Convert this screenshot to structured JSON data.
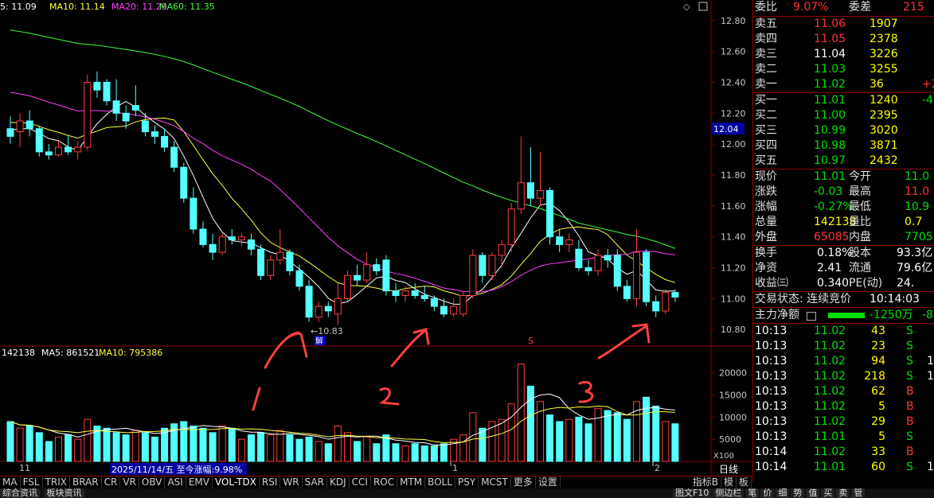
{
  "ma_legend": {
    "ma5": "5: 11.09",
    "ma10": "MA10: 11.14",
    "ma20": "MA20: 11.29",
    "ma60": "MA60: 11.35"
  },
  "price_axis": [
    "12.80",
    "12.60",
    "12.40",
    "12.20",
    "12.00",
    "11.80",
    "11.60",
    "11.40",
    "11.20",
    "11.00",
    "10.80"
  ],
  "current_price_tag": "12.04",
  "low_marker": "10.83",
  "jie_marker": "解",
  "s_marker": "S",
  "volume_legend": {
    "vol": "142138",
    "ma5": "MA5: 861521",
    "ma10": "MA10: 795386"
  },
  "volume_axis": [
    "20000",
    "15000",
    "10000",
    "5000"
  ],
  "volume_unit": "X100",
  "date_axis": {
    "d1": "11",
    "d2": "1",
    "d3": "2"
  },
  "date_tooltip": "2025/11/14/五 至今涨幅:9.98%",
  "daily_label": "日线",
  "annotations": [
    "1",
    "2",
    "3"
  ],
  "right_panel": {
    "weibi_label": "委比",
    "weibi_value": "9.07%",
    "weicha_label": "委差",
    "weicha_value": "215",
    "asks": [
      {
        "label": "卖五",
        "price": "11.06",
        "vol": "1907",
        "extra": ""
      },
      {
        "label": "卖四",
        "price": "11.05",
        "vol": "2378",
        "extra": ""
      },
      {
        "label": "卖三",
        "price": "11.04",
        "vol": "3226",
        "extra": ""
      },
      {
        "label": "卖二",
        "price": "11.03",
        "vol": "3255",
        "extra": ""
      },
      {
        "label": "卖一",
        "price": "11.02",
        "vol": "36",
        "extra": "+2"
      }
    ],
    "bids": [
      {
        "label": "买一",
        "price": "11.01",
        "vol": "1240",
        "extra": "-4"
      },
      {
        "label": "买二",
        "price": "11.00",
        "vol": "2395",
        "extra": ""
      },
      {
        "label": "买三",
        "price": "10.99",
        "vol": "3020",
        "extra": ""
      },
      {
        "label": "买四",
        "price": "10.98",
        "vol": "3871",
        "extra": ""
      },
      {
        "label": "买五",
        "price": "10.97",
        "vol": "2432",
        "extra": ""
      }
    ],
    "stats": [
      {
        "l1": "现价",
        "v1": "11.01",
        "l2": "今开",
        "v2": "11.0"
      },
      {
        "l1": "涨跌",
        "v1": "-0.03",
        "l2": "最高",
        "v2": "11.0"
      },
      {
        "l1": "涨幅",
        "v1": "-0.27%",
        "l2": "最低",
        "v2": "10.9"
      },
      {
        "l1": "总量",
        "v1": "142138",
        "l2": "量比",
        "v2": "0.7"
      },
      {
        "l1": "外盘",
        "v1": "65085",
        "l2": "内盘",
        "v2": "7705"
      }
    ],
    "stats2": [
      {
        "l1": "换手",
        "v1": "0.18%",
        "l2": "股本",
        "v2": "93.3亿"
      },
      {
        "l1": "净资",
        "v1": "2.41",
        "l2": "流通",
        "v2": "79.6亿"
      },
      {
        "l1": "收益㈢",
        "v1": "0.340",
        "l2": "PE(动)",
        "v2": "24."
      }
    ],
    "trade_status": "交易状态: 连续竞价",
    "trade_time": "10:14:03",
    "net_flow_label": "主力净额",
    "net_flow_value": "-1250万",
    "net_flow_extra": "-8",
    "ticks": [
      {
        "time": "10:13",
        "price": "11.02",
        "vol": "43",
        "side": "S",
        "n": ""
      },
      {
        "time": "10:13",
        "price": "11.02",
        "vol": "23",
        "side": "S",
        "n": ""
      },
      {
        "time": "10:13",
        "price": "11.02",
        "vol": "94",
        "side": "S",
        "n": "1"
      },
      {
        "time": "10:13",
        "price": "11.02",
        "vol": "218",
        "side": "S",
        "n": "1"
      },
      {
        "time": "10:13",
        "price": "11.02",
        "vol": "62",
        "side": "B",
        "n": ""
      },
      {
        "time": "10:13",
        "price": "11.02",
        "vol": "5",
        "side": "B",
        "n": ""
      },
      {
        "time": "10:13",
        "price": "11.02",
        "vol": "29",
        "side": "B",
        "n": ""
      },
      {
        "time": "10:13",
        "price": "11.01",
        "vol": "5",
        "side": "S",
        "n": ""
      },
      {
        "time": "10:14",
        "price": "11.02",
        "vol": "33",
        "side": "B",
        "n": ""
      },
      {
        "time": "10:14",
        "price": "11.01",
        "vol": "60",
        "side": "S",
        "n": "1"
      }
    ]
  },
  "indicator_tabs": [
    "MA",
    "FSL",
    "TRIX",
    "BRAR",
    "CR",
    "VR",
    "OBV",
    "ASI",
    "EMV",
    "VOL-TDX",
    "RSI",
    "WR",
    "SAR",
    "KDJ",
    "CCI",
    "ROC",
    "MTM",
    "BOLL",
    "PSY",
    "MCST",
    "更多",
    "设置"
  ],
  "indicator_right": [
    "指标B",
    "模",
    "板"
  ],
  "bottom_tabs": [
    "综合资讯",
    "板块资讯"
  ],
  "bottom_right": [
    "图文F10",
    "侧边栏",
    "笔",
    "价",
    "细",
    "势",
    "值",
    "买",
    "卖",
    "管"
  ],
  "candles": [
    {
      "o": 12.1,
      "h": 12.18,
      "l": 12.0,
      "c": 12.05
    },
    {
      "o": 12.08,
      "h": 12.2,
      "l": 11.98,
      "c": 12.15
    },
    {
      "o": 12.15,
      "h": 12.22,
      "l": 12.05,
      "c": 12.1
    },
    {
      "o": 12.1,
      "h": 12.12,
      "l": 11.92,
      "c": 11.95
    },
    {
      "o": 11.95,
      "h": 12.0,
      "l": 11.9,
      "c": 11.93
    },
    {
      "o": 11.93,
      "h": 12.02,
      "l": 11.92,
      "c": 11.98
    },
    {
      "o": 11.98,
      "h": 12.05,
      "l": 11.93,
      "c": 11.95
    },
    {
      "o": 11.95,
      "h": 12.02,
      "l": 11.9,
      "c": 11.98
    },
    {
      "o": 11.98,
      "h": 12.45,
      "l": 11.96,
      "c": 12.4
    },
    {
      "o": 12.4,
      "h": 12.47,
      "l": 12.3,
      "c": 12.35
    },
    {
      "o": 12.4,
      "h": 12.42,
      "l": 12.25,
      "c": 12.28
    },
    {
      "o": 12.28,
      "h": 12.42,
      "l": 12.15,
      "c": 12.2
    },
    {
      "o": 12.2,
      "h": 12.25,
      "l": 12.1,
      "c": 12.15
    },
    {
      "o": 12.25,
      "h": 12.38,
      "l": 12.18,
      "c": 12.22
    },
    {
      "o": 12.15,
      "h": 12.2,
      "l": 12.05,
      "c": 12.08
    },
    {
      "o": 12.08,
      "h": 12.12,
      "l": 12.0,
      "c": 12.05
    },
    {
      "o": 12.05,
      "h": 12.1,
      "l": 11.95,
      "c": 11.98
    },
    {
      "o": 11.98,
      "h": 12.02,
      "l": 11.82,
      "c": 11.85
    },
    {
      "o": 11.85,
      "h": 11.88,
      "l": 11.62,
      "c": 11.65
    },
    {
      "o": 11.65,
      "h": 11.72,
      "l": 11.42,
      "c": 11.45
    },
    {
      "o": 11.45,
      "h": 11.5,
      "l": 11.33,
      "c": 11.35
    },
    {
      "o": 11.35,
      "h": 11.42,
      "l": 11.25,
      "c": 11.3
    },
    {
      "o": 11.3,
      "h": 11.42,
      "l": 11.28,
      "c": 11.4
    },
    {
      "o": 11.4,
      "h": 11.45,
      "l": 11.35,
      "c": 11.38
    },
    {
      "o": 11.38,
      "h": 11.42,
      "l": 11.34,
      "c": 11.4
    },
    {
      "o": 11.38,
      "h": 11.42,
      "l": 11.28,
      "c": 11.32
    },
    {
      "o": 11.32,
      "h": 11.35,
      "l": 11.12,
      "c": 11.15
    },
    {
      "o": 11.15,
      "h": 11.28,
      "l": 11.12,
      "c": 11.25
    },
    {
      "o": 11.25,
      "h": 11.45,
      "l": 11.22,
      "c": 11.3
    },
    {
      "o": 11.3,
      "h": 11.32,
      "l": 11.15,
      "c": 11.18
    },
    {
      "o": 11.18,
      "h": 11.22,
      "l": 11.05,
      "c": 11.08
    },
    {
      "o": 11.08,
      "h": 11.12,
      "l": 10.85,
      "c": 10.88
    },
    {
      "o": 10.88,
      "h": 10.98,
      "l": 10.85,
      "c": 10.95
    },
    {
      "o": 10.95,
      "h": 10.98,
      "l": 10.88,
      "c": 10.92
    },
    {
      "o": 10.9,
      "h": 11.1,
      "l": 10.83,
      "c": 11.0
    },
    {
      "o": 11.0,
      "h": 11.18,
      "l": 10.98,
      "c": 11.15
    },
    {
      "o": 11.15,
      "h": 11.22,
      "l": 11.08,
      "c": 11.12
    },
    {
      "o": 11.12,
      "h": 11.3,
      "l": 11.1,
      "c": 11.22
    },
    {
      "o": 11.22,
      "h": 11.26,
      "l": 11.15,
      "c": 11.18
    },
    {
      "o": 11.25,
      "h": 11.28,
      "l": 11.02,
      "c": 11.05
    },
    {
      "o": 11.05,
      "h": 11.1,
      "l": 10.98,
      "c": 11.02
    },
    {
      "o": 11.02,
      "h": 11.08,
      "l": 10.98,
      "c": 11.05
    },
    {
      "o": 11.05,
      "h": 11.1,
      "l": 11.0,
      "c": 11.02
    },
    {
      "o": 11.02,
      "h": 11.08,
      "l": 10.98,
      "c": 11.0
    },
    {
      "o": 11.0,
      "h": 11.02,
      "l": 10.92,
      "c": 10.95
    },
    {
      "o": 10.95,
      "h": 11.0,
      "l": 10.88,
      "c": 10.9
    },
    {
      "o": 10.9,
      "h": 11.0,
      "l": 10.88,
      "c": 10.95
    },
    {
      "o": 10.9,
      "h": 11.05,
      "l": 10.88,
      "c": 11.02
    },
    {
      "o": 11.02,
      "h": 11.32,
      "l": 11.0,
      "c": 11.28
    },
    {
      "o": 11.28,
      "h": 11.3,
      "l": 11.1,
      "c": 11.15
    },
    {
      "o": 11.15,
      "h": 11.3,
      "l": 11.12,
      "c": 11.28
    },
    {
      "o": 11.28,
      "h": 11.38,
      "l": 11.2,
      "c": 11.35
    },
    {
      "o": 11.35,
      "h": 11.62,
      "l": 11.3,
      "c": 11.58
    },
    {
      "o": 11.58,
      "h": 12.05,
      "l": 11.55,
      "c": 11.75
    },
    {
      "o": 11.75,
      "h": 11.98,
      "l": 11.6,
      "c": 11.65
    },
    {
      "o": 11.65,
      "h": 11.95,
      "l": 11.6,
      "c": 11.7
    },
    {
      "o": 11.7,
      "h": 11.72,
      "l": 11.35,
      "c": 11.4
    },
    {
      "o": 11.4,
      "h": 11.45,
      "l": 11.3,
      "c": 11.35
    },
    {
      "o": 11.35,
      "h": 11.42,
      "l": 11.3,
      "c": 11.38
    },
    {
      "o": 11.32,
      "h": 11.38,
      "l": 11.18,
      "c": 11.2
    },
    {
      "o": 11.2,
      "h": 11.25,
      "l": 11.15,
      "c": 11.18
    },
    {
      "o": 11.18,
      "h": 11.32,
      "l": 11.15,
      "c": 11.28
    },
    {
      "o": 11.28,
      "h": 11.32,
      "l": 11.2,
      "c": 11.25
    },
    {
      "o": 11.28,
      "h": 11.32,
      "l": 11.05,
      "c": 11.08
    },
    {
      "o": 11.08,
      "h": 11.12,
      "l": 10.98,
      "c": 11.0
    },
    {
      "o": 11.0,
      "h": 11.45,
      "l": 10.95,
      "c": 11.3
    },
    {
      "o": 11.3,
      "h": 11.32,
      "l": 10.95,
      "c": 10.98
    },
    {
      "o": 10.98,
      "h": 11.02,
      "l": 10.88,
      "c": 10.92
    },
    {
      "o": 10.92,
      "h": 11.06,
      "l": 10.9,
      "c": 11.04
    },
    {
      "o": 11.04,
      "h": 11.06,
      "l": 10.98,
      "c": 11.01
    }
  ],
  "volumes": [
    {
      "v": 9000,
      "up": false
    },
    {
      "v": 7500,
      "up": true
    },
    {
      "v": 8000,
      "up": false
    },
    {
      "v": 6500,
      "up": false
    },
    {
      "v": 4500,
      "up": false
    },
    {
      "v": 5500,
      "up": true
    },
    {
      "v": 6000,
      "up": false
    },
    {
      "v": 5000,
      "up": true
    },
    {
      "v": 9500,
      "up": true
    },
    {
      "v": 8000,
      "up": false
    },
    {
      "v": 7500,
      "up": false
    },
    {
      "v": 6500,
      "up": false
    },
    {
      "v": 6000,
      "up": false
    },
    {
      "v": 7000,
      "up": true
    },
    {
      "v": 6500,
      "up": false
    },
    {
      "v": 5500,
      "up": false
    },
    {
      "v": 7500,
      "up": false
    },
    {
      "v": 8500,
      "up": false
    },
    {
      "v": 9000,
      "up": false
    },
    {
      "v": 8000,
      "up": false
    },
    {
      "v": 7500,
      "up": false
    },
    {
      "v": 6500,
      "up": false
    },
    {
      "v": 8000,
      "up": true
    },
    {
      "v": 7500,
      "up": false
    },
    {
      "v": 5000,
      "up": true
    },
    {
      "v": 6000,
      "up": false
    },
    {
      "v": 6500,
      "up": false
    },
    {
      "v": 6000,
      "up": true
    },
    {
      "v": 7000,
      "up": true
    },
    {
      "v": 6000,
      "up": false
    },
    {
      "v": 5000,
      "up": false
    },
    {
      "v": 5500,
      "up": false
    },
    {
      "v": 4500,
      "up": true
    },
    {
      "v": 4000,
      "up": false
    },
    {
      "v": 8000,
      "up": true
    },
    {
      "v": 6500,
      "up": true
    },
    {
      "v": 4500,
      "up": false
    },
    {
      "v": 5500,
      "up": true
    },
    {
      "v": 4000,
      "up": false
    },
    {
      "v": 6000,
      "up": false
    },
    {
      "v": 4000,
      "up": false
    },
    {
      "v": 3500,
      "up": true
    },
    {
      "v": 4000,
      "up": false
    },
    {
      "v": 3500,
      "up": false
    },
    {
      "v": 3500,
      "up": false
    },
    {
      "v": 4000,
      "up": false
    },
    {
      "v": 5000,
      "up": true
    },
    {
      "v": 6000,
      "up": true
    },
    {
      "v": 11000,
      "up": true
    },
    {
      "v": 7500,
      "up": false
    },
    {
      "v": 9000,
      "up": true
    },
    {
      "v": 9500,
      "up": true
    },
    {
      "v": 13000,
      "up": true
    },
    {
      "v": 22000,
      "up": true
    },
    {
      "v": 17000,
      "up": false
    },
    {
      "v": 13500,
      "up": true
    },
    {
      "v": 10500,
      "up": false
    },
    {
      "v": 9000,
      "up": false
    },
    {
      "v": 9500,
      "up": true
    },
    {
      "v": 10000,
      "up": false
    },
    {
      "v": 8500,
      "up": false
    },
    {
      "v": 12000,
      "up": true
    },
    {
      "v": 11500,
      "up": false
    },
    {
      "v": 11000,
      "up": false
    },
    {
      "v": 9500,
      "up": false
    },
    {
      "v": 13500,
      "up": true
    },
    {
      "v": 14500,
      "up": false
    },
    {
      "v": 12500,
      "up": false
    },
    {
      "v": 9000,
      "up": true
    },
    {
      "v": 8500,
      "up": false
    }
  ],
  "colors": {
    "up": "#ff3c3c",
    "down": "#54ffff",
    "ma5": "#ffffff",
    "ma10": "#ffff40",
    "ma20": "#ff40ff",
    "ma60": "#40ff40",
    "axis": "#8b0000",
    "annotation": "#ff4040"
  }
}
